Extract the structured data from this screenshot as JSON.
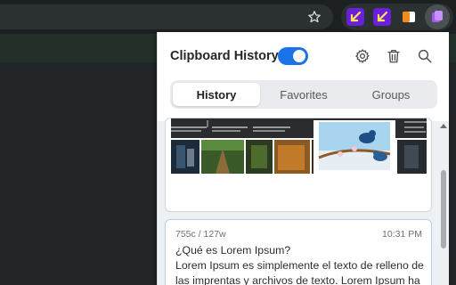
{
  "browser": {
    "toolbar_icons": [
      "bookmark-star-icon",
      "purple-arrow-extension-icon",
      "purple-arrow-extension-icon",
      "orange-white-extension-icon",
      "clipboard-extension-icon"
    ],
    "colors": {
      "toolbar_bg": "#1c2020",
      "bookmarks_bar_bg": "#233029",
      "extension_purple": "#6a1fd8"
    }
  },
  "popup": {
    "title": "Clipboard History",
    "toggle_enabled": true,
    "header_icons": [
      "gear-icon",
      "trash-icon",
      "search-icon"
    ],
    "accent_color": "#1a73e8",
    "tabs": [
      {
        "label": "History",
        "selected": true
      },
      {
        "label": "Favorites",
        "selected": false
      },
      {
        "label": "Groups",
        "selected": false
      }
    ],
    "clips": [
      {
        "type": "image",
        "description_icons": [
          "screenshot-thumbnails"
        ]
      },
      {
        "type": "text",
        "meta": "755c / 127w",
        "time": "10:31 PM",
        "lines": [
          "¿Qué es Lorem Ipsum?",
          "Lorem Ipsum es simplemente el texto de relleno de",
          "las imprentas y archivos de texto. Lorem Ipsum ha"
        ]
      }
    ]
  }
}
